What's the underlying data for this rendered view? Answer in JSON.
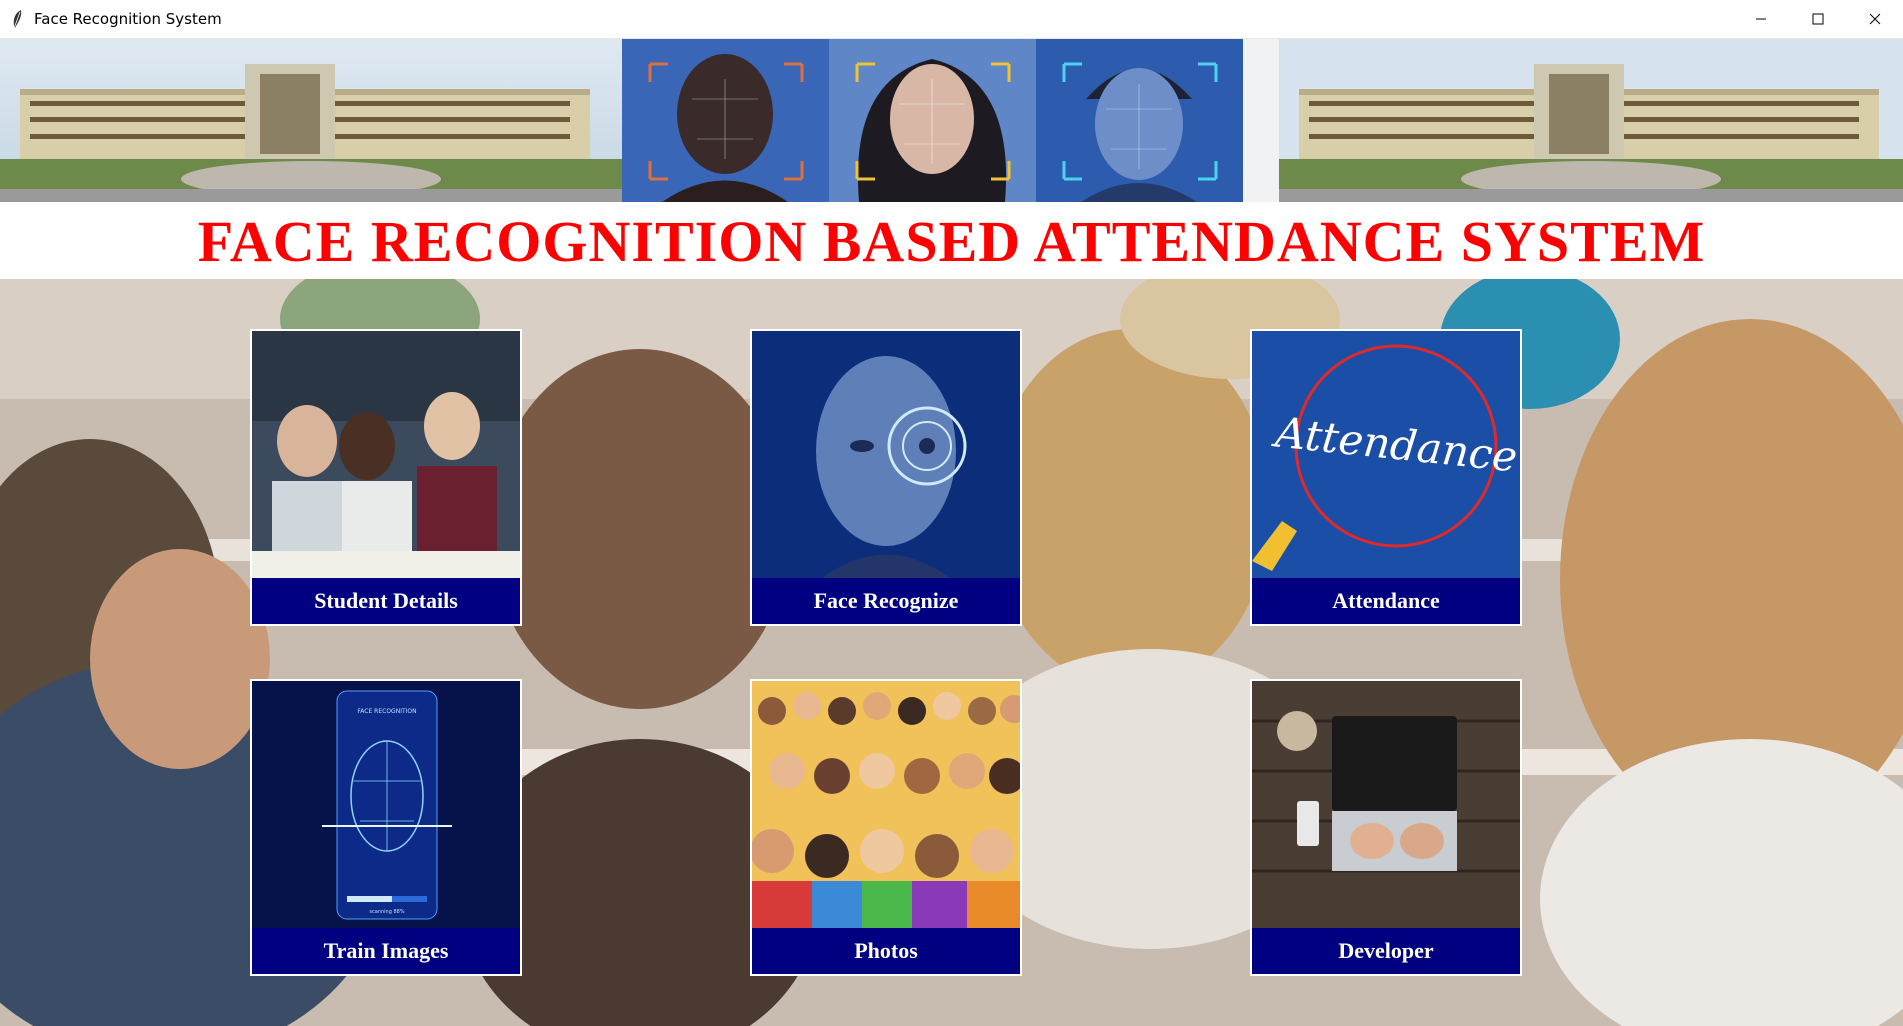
{
  "window": {
    "title": "Face Recognition System",
    "controls": [
      "minimize-icon",
      "maximize-icon",
      "close-icon"
    ]
  },
  "banner": {
    "images": [
      "campus-building",
      "face-scan-man",
      "face-scan-woman",
      "face-scan-man-2",
      "campus-building"
    ]
  },
  "heading": {
    "text": "FACE RECOGNITION BASED ATTENDANCE SYSTEM",
    "color": "#ff0000"
  },
  "cards": [
    {
      "label": "Student Details",
      "icon": "students-image"
    },
    {
      "label": "Face Recognize",
      "icon": "face-scan-image"
    },
    {
      "label": "Attendance",
      "icon": "attendance-image",
      "image_text": "Attendance"
    },
    {
      "label": "Train Images",
      "icon": "face-mesh-image",
      "image_text": "FACE RECOGNITION",
      "image_subtext": "scanning 88%"
    },
    {
      "label": "Photos",
      "icon": "crowd-image"
    },
    {
      "label": "Developer",
      "icon": "laptop-image"
    }
  ],
  "colors": {
    "button_bg": "#000080",
    "button_text": "#ffffff",
    "heading": "#ff0000"
  }
}
